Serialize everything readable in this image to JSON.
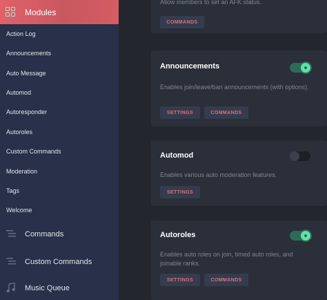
{
  "sidebar": {
    "header_label": "Modules",
    "items": [
      {
        "label": "Action Log"
      },
      {
        "label": "Announcements"
      },
      {
        "label": "Auto Message"
      },
      {
        "label": "Automod"
      },
      {
        "label": "Autoresponder"
      },
      {
        "label": "Autoroles"
      },
      {
        "label": "Custom Commands"
      },
      {
        "label": "Moderation"
      },
      {
        "label": "Tags"
      },
      {
        "label": "Welcome"
      }
    ],
    "sections": [
      {
        "label": "Commands",
        "icon": "list-icon"
      },
      {
        "label": "Custom Commands",
        "icon": "list-icon"
      },
      {
        "label": "Music Queue",
        "icon": "music-note-icon"
      }
    ]
  },
  "cards": [
    {
      "title": "",
      "description": "Allow members to set an AFK status.",
      "buttons": [
        "COMMANDS"
      ]
    },
    {
      "title": "Announcements",
      "description": "Enables join/leave/ban announcements (with options).",
      "enabled": true,
      "buttons": [
        "SETTINGS",
        "COMMANDS"
      ]
    },
    {
      "title": "Automod",
      "description": "Enables various auto moderation features.",
      "enabled": false,
      "buttons": [
        "SETTINGS"
      ]
    },
    {
      "title": "Autoroles",
      "description": "Enables auto roles on join, timed auto roles, and joinable ranks.",
      "enabled": true,
      "buttons": [
        "SETTINGS",
        "COMMANDS"
      ]
    }
  ],
  "colors": {
    "accent": "#e2606a",
    "toggle_on": "#5ee3a6",
    "sidebar_bg": "#28304a",
    "main_bg": "#23262e"
  }
}
